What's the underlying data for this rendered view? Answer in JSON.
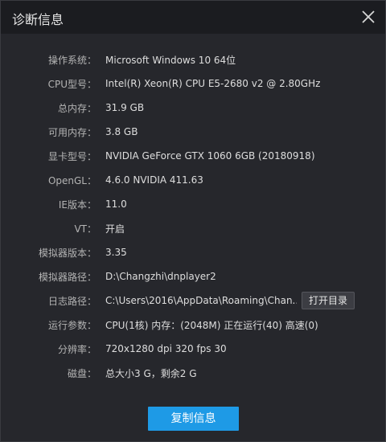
{
  "window": {
    "title": "诊断信息",
    "close_icon": "close-icon"
  },
  "rows": [
    {
      "label": "操作系统：",
      "value": "Microsoft Windows 10 64位"
    },
    {
      "label": "CPU型号：",
      "value": "Intel(R) Xeon(R) CPU E5-2680 v2 @ 2.80GHz"
    },
    {
      "label": "总内存：",
      "value": "31.9 GB"
    },
    {
      "label": "可用内存：",
      "value": "3.8 GB"
    },
    {
      "label": "显卡型号：",
      "value": "NVIDIA GeForce GTX 1060 6GB (20180918)"
    },
    {
      "label": "OpenGL：",
      "value": "4.6.0 NVIDIA 411.63"
    },
    {
      "label": "IE版本：",
      "value": "11.0"
    },
    {
      "label": "VT：",
      "value": "开启"
    },
    {
      "label": "模拟器版本：",
      "value": "3.35"
    },
    {
      "label": "模拟器路径：",
      "value": "D:\\Changzhi\\dnplayer2"
    },
    {
      "label": "日志路径：",
      "value": "C:\\Users\\2016\\AppData\\Roaming\\Chan..."
    },
    {
      "label": "运行参数：",
      "value": "CPU(1核) 内存：(2048M) 正在运行(40) 高速(0)"
    },
    {
      "label": "分辨率：",
      "value": "720x1280 dpi 320 fps 30"
    },
    {
      "label": "磁盘：",
      "value": "总大小3 G，剩余2 G"
    }
  ],
  "buttons": {
    "open_dir": "打开目录",
    "copy": "复制信息"
  },
  "colors": {
    "background": "#26272c",
    "titlebar": "#1b1c20",
    "accent": "#1e9ae6"
  }
}
